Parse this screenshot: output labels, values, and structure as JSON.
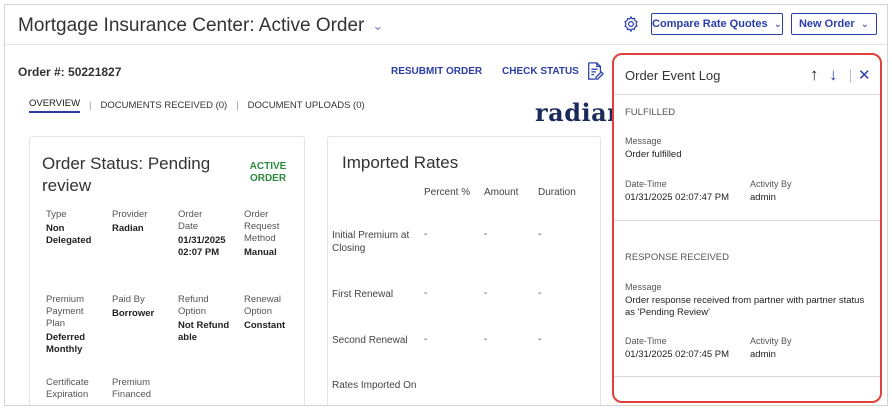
{
  "header": {
    "title": "Mortgage Insurance Center: Active Order",
    "compare_label": "Compare Rate Quotes",
    "new_order_label": "New Order"
  },
  "order": {
    "number_label": "Order #: 50221827",
    "resubmit_label": "RESUBMIT ORDER",
    "check_status_label": "CHECK STATUS"
  },
  "tabs": [
    {
      "label": "OVERVIEW",
      "active": true
    },
    {
      "label": "DOCUMENTS RECEIVED (0)",
      "active": false
    },
    {
      "label": "DOCUMENT UPLOADS (0)",
      "active": false
    }
  ],
  "brand": "radian",
  "status_card": {
    "title": "Order Status: Pending review",
    "badge": "ACTIVE ORDER",
    "fields": {
      "type": {
        "label": "Type",
        "value": "Non Delegated"
      },
      "provider": {
        "label": "Provider",
        "value": "Radian"
      },
      "order_date": {
        "label": "Order Date",
        "value": "01/31/2025 02:07 PM"
      },
      "request_method": {
        "label": "Order Request Method",
        "value": "Manual"
      },
      "premium_plan": {
        "label": "Premium Payment Plan",
        "value": "Deferred Monthly"
      },
      "paid_by": {
        "label": "Paid By",
        "value": "Borrower"
      },
      "refund_option": {
        "label": "Refund Option",
        "value": "Not Refundable"
      },
      "renewal_option": {
        "label": "Renewal Option",
        "value": "Constant"
      },
      "cert_expiration": {
        "label": "Certificate Expiration",
        "value": ""
      },
      "premium_financed": {
        "label": "Premium Financed",
        "value": ""
      }
    }
  },
  "rates_card": {
    "title": "Imported Rates",
    "columns": [
      "Percent %",
      "Amount",
      "Duration"
    ],
    "rows": [
      {
        "label": "Initial Premium at Closing",
        "values": [
          "-",
          "-",
          "-"
        ]
      },
      {
        "label": "First Renewal",
        "values": [
          "-",
          "-",
          "-"
        ]
      },
      {
        "label": "Second Renewal",
        "values": [
          "-",
          "-",
          "-"
        ]
      },
      {
        "label": "Rates Imported On",
        "values": [
          "",
          "",
          ""
        ]
      }
    ]
  },
  "event_log": {
    "title": "Order Event Log",
    "events": [
      {
        "type": "FULFILLED",
        "message_label": "Message",
        "message": "Order fulfilled",
        "datetime_label": "Date-Time",
        "datetime": "01/31/2025 02:07:47 PM",
        "activity_label": "Activity By",
        "activity_by": "admin"
      },
      {
        "type": "RESPONSE RECEIVED",
        "message_label": "Message",
        "message": "Order response received from partner with partner status as 'Pending Review'",
        "datetime_label": "Date-Time",
        "datetime": "01/31/2025 02:07:45 PM",
        "activity_label": "Activity By",
        "activity_by": "admin"
      }
    ]
  },
  "colors": {
    "accent": "#2b3ea8",
    "active_badge": "#2e8b3d",
    "highlight_border": "#e0413b"
  },
  "icons": [
    "chevron-down-icon",
    "gear-icon",
    "document-edit-icon",
    "arrow-up-icon",
    "arrow-down-icon",
    "close-icon"
  ]
}
